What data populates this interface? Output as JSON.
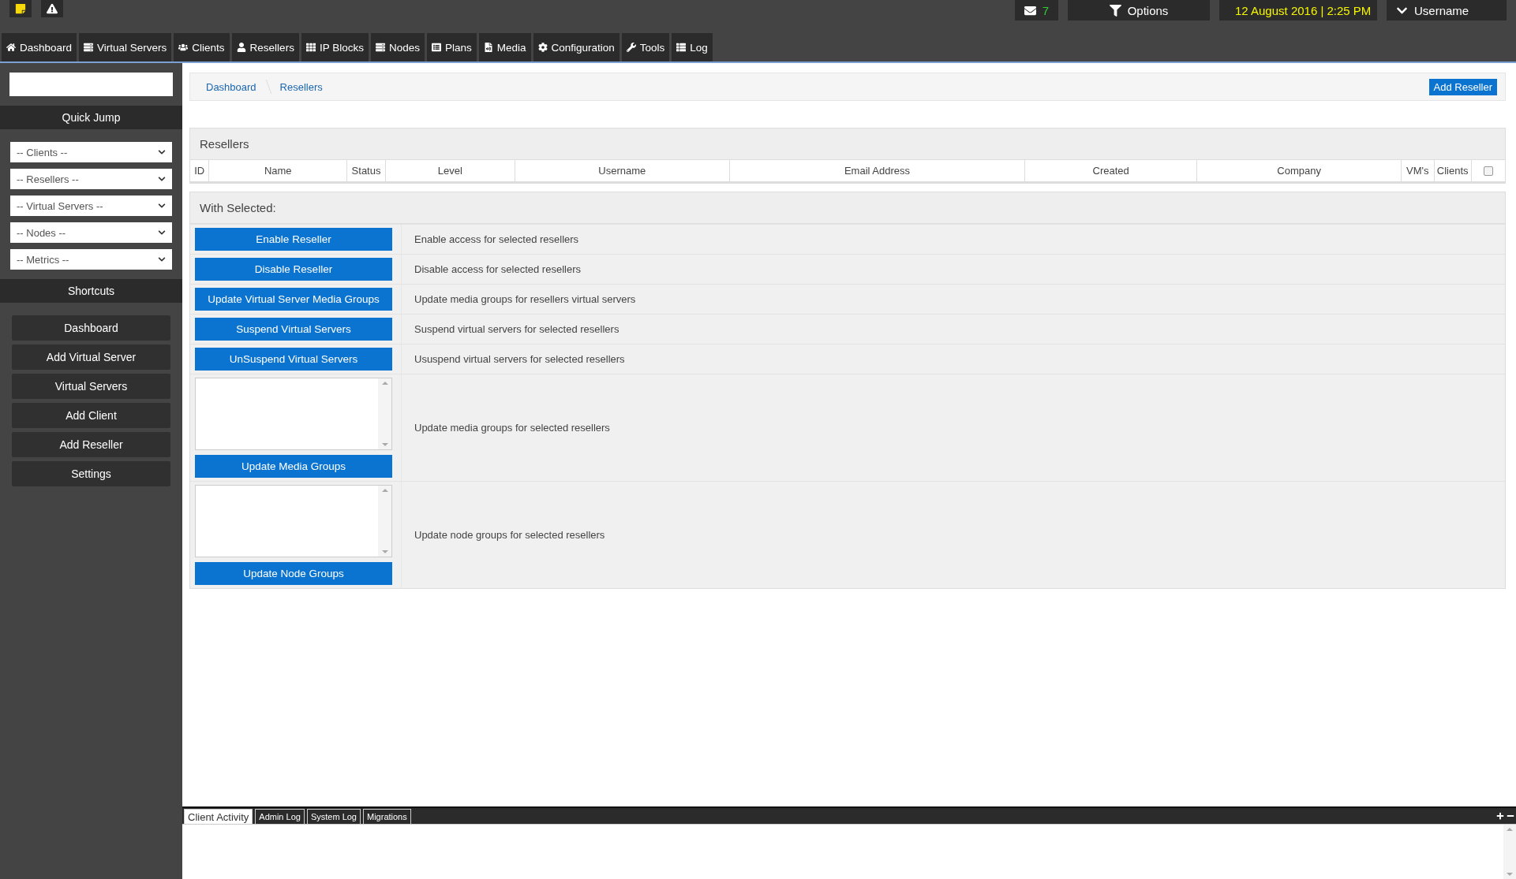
{
  "top_bar": {
    "mail_count": "7",
    "options": "Options",
    "datetime": "12 August 2016 | 2:25 PM",
    "user": "Username"
  },
  "nav": [
    "Dashboard",
    "Virtual Servers",
    "Clients",
    "Resellers",
    "IP Blocks",
    "Nodes",
    "Plans",
    "Media",
    "Configuration",
    "Tools",
    "Log"
  ],
  "quick_jump": {
    "title": "Quick Jump",
    "selects": [
      "-- Clients --",
      "-- Resellers --",
      "-- Virtual Servers --",
      "-- Nodes --",
      "-- Metrics --"
    ]
  },
  "shortcuts": {
    "title": "Shortcuts",
    "items": [
      "Dashboard",
      "Add Virtual Server",
      "Virtual Servers",
      "Add Client",
      "Add Reseller",
      "Settings"
    ]
  },
  "breadcrumb": [
    "Dashboard",
    "Resellers"
  ],
  "add_button": "Add Reseller",
  "table": {
    "title": "Resellers",
    "columns": [
      "ID",
      "Name",
      "Status",
      "Level",
      "Username",
      "Email Address",
      "Created",
      "Company",
      "VM's",
      "Clients"
    ],
    "select_all_checked": false
  },
  "with_selected": {
    "title": "With Selected:",
    "actions": [
      {
        "kind": "button",
        "button": "Enable Reseller",
        "description": "Enable access for selected resellers"
      },
      {
        "kind": "button",
        "button": "Disable Reseller",
        "description": "Disable access for selected resellers"
      },
      {
        "kind": "button",
        "button": "Update Virtual Server Media Groups",
        "description": "Update media groups for resellers virtual servers"
      },
      {
        "kind": "button",
        "button": "Suspend Virtual Servers",
        "description": "Suspend virtual servers for selected resellers"
      },
      {
        "kind": "button",
        "button": "UnSuspend Virtual Servers",
        "description": "Ususpend virtual servers for selected resellers"
      },
      {
        "kind": "listbox",
        "button": "Update Media Groups",
        "description": "Update media groups for selected resellers"
      },
      {
        "kind": "listbox",
        "button": "Update Node Groups",
        "description": "Update node groups for selected resellers"
      }
    ]
  },
  "bottom_panel": {
    "tabs": [
      {
        "label": "Client Activity",
        "selected": true
      },
      {
        "label": "Admin Log",
        "selected": false
      },
      {
        "label": "System Log",
        "selected": false
      },
      {
        "label": "Migrations",
        "selected": false
      }
    ]
  }
}
